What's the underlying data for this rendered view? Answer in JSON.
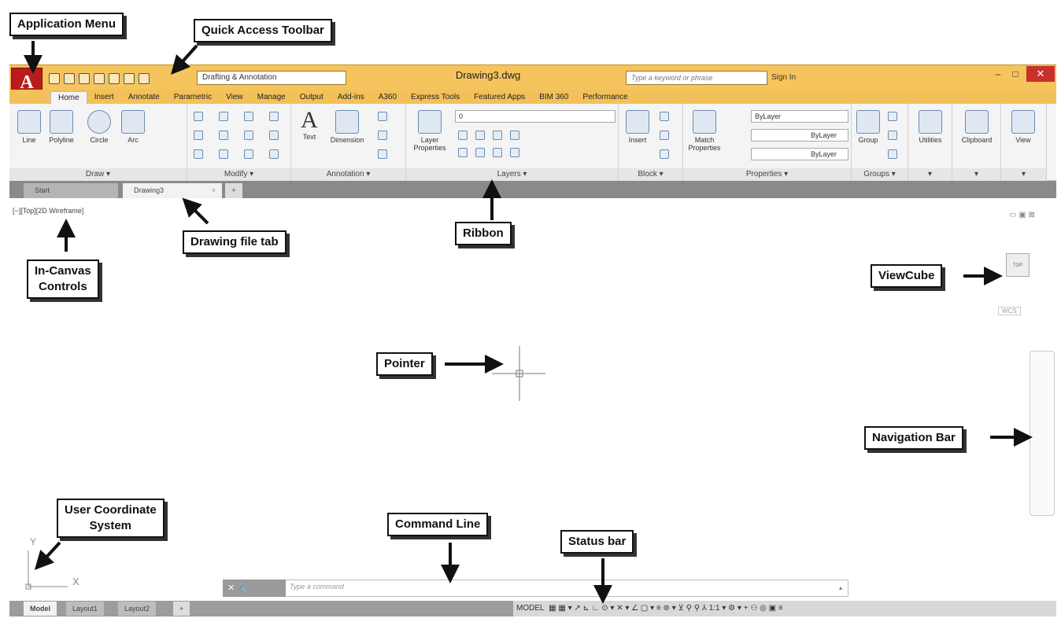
{
  "callouts": {
    "application_menu": "Application Menu",
    "quick_access_toolbar": "Quick Access Toolbar",
    "drawing_file_tab": "Drawing file tab",
    "ribbon": "Ribbon",
    "in_canvas_controls_1": "In-Canvas",
    "in_canvas_controls_2": "Controls",
    "viewcube": "ViewCube",
    "pointer": "Pointer",
    "navigation_bar": "Navigation Bar",
    "ucs_1": "User Coordinate",
    "ucs_2": "System",
    "command_line": "Command Line",
    "status_bar": "Status bar"
  },
  "titlebar": {
    "app_button": "A",
    "workspace": "Drafting & Annotation",
    "title": "Drawing3.dwg",
    "search_placeholder": "Type a keyword or phrase",
    "sign_in": "Sign In"
  },
  "ribbon_tabs": [
    "Home",
    "Insert",
    "Annotate",
    "Parametric",
    "View",
    "Manage",
    "Output",
    "Add-ins",
    "A360",
    "Express Tools",
    "Featured Apps",
    "BIM 360",
    "Performance"
  ],
  "draw": {
    "line": "Line",
    "polyline": "Polyline",
    "circle": "Circle",
    "arc": "Arc",
    "label": "Draw ▾"
  },
  "modify": {
    "label": "Modify ▾"
  },
  "annotation": {
    "text": "Text",
    "dimension": "Dimension",
    "label": "Annotation ▾"
  },
  "layers": {
    "layer_properties_1": "Layer",
    "layer_properties_2": "Properties",
    "current_layer": "0",
    "label": "Layers ▾"
  },
  "block": {
    "insert": "Insert",
    "label": "Block ▾"
  },
  "properties": {
    "match_1": "Match",
    "match_2": "Properties",
    "color": "ByLayer",
    "linetype": "ByLayer",
    "lineweight": "ByLayer",
    "label": "Properties ▾"
  },
  "groups": {
    "group": "Group",
    "label": "Groups ▾"
  },
  "utilities": {
    "label": "Utilities"
  },
  "clipboard": {
    "label": "Clipboard"
  },
  "view": {
    "label": "View"
  },
  "doc_tabs": {
    "start": "Start",
    "drawing": "Drawing3"
  },
  "canvas_controls": "[−][Top][2D Wireframe]",
  "viewcube": {
    "face": "TOP",
    "wcs": "WCS"
  },
  "ucs": {
    "x": "X",
    "y": "Y"
  },
  "command": {
    "placeholder": "Type a command"
  },
  "layout_tabs": [
    "Model",
    "Layout1",
    "Layout2"
  ],
  "status": {
    "model": "MODEL",
    "scale": "1:1"
  }
}
